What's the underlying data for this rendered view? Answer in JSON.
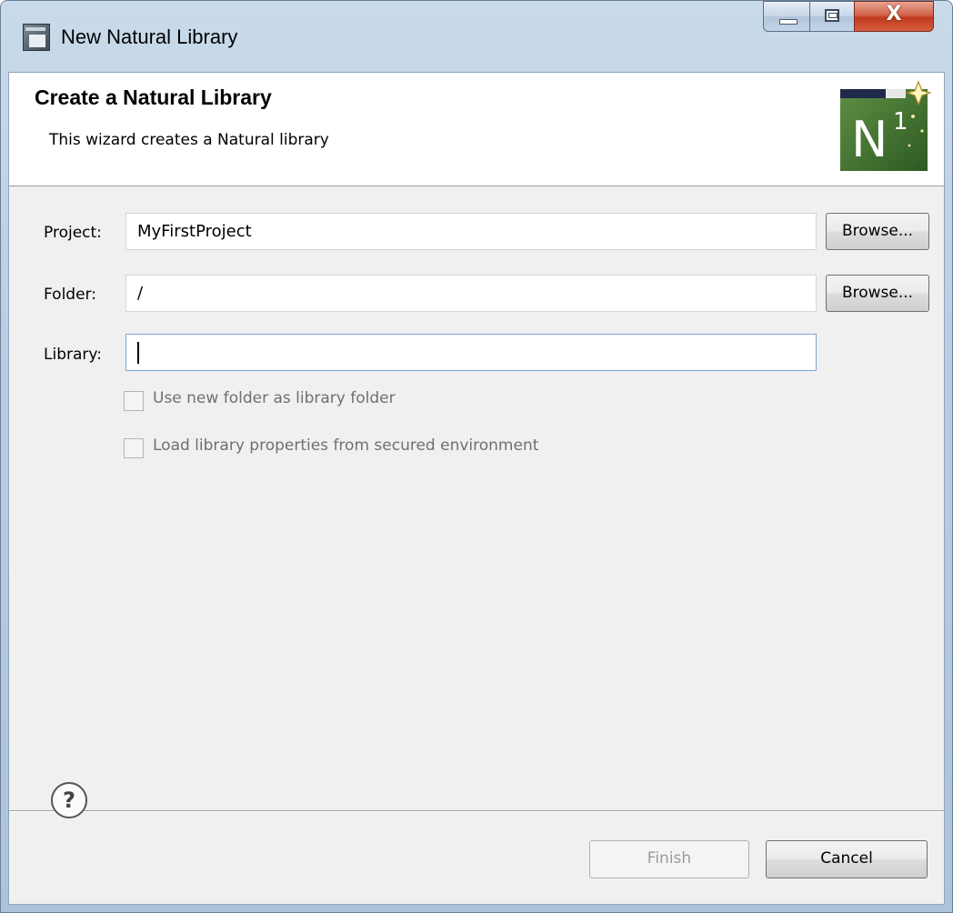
{
  "window": {
    "title": "New Natural Library"
  },
  "title_buttons": {
    "close_glyph": "X"
  },
  "header": {
    "title": "Create a Natural Library",
    "description": "This wizard creates a Natural library",
    "icon": "natural-library-wizard-icon",
    "icon_letter": "N",
    "icon_superscript": "1"
  },
  "form": {
    "project_label": "Project:",
    "project_value": "MyFirstProject",
    "folder_label": "Folder:",
    "folder_value": "/",
    "library_label": "Library:",
    "library_value": "",
    "browse_label": "Browse..."
  },
  "options": {
    "use_new_folder": {
      "label": "Use new folder as library folder",
      "checked": false,
      "enabled": false
    },
    "load_properties": {
      "label": "Load library properties from secured environment",
      "checked": false,
      "enabled": false
    }
  },
  "footer": {
    "help_glyph": "?",
    "finish_label": "Finish",
    "cancel_label": "Cancel"
  },
  "colors": {
    "header_background": "#ffffff",
    "body_background": "#f0f0f0",
    "icon_green": "#3f6e2e",
    "close_red": "#c0391e"
  }
}
